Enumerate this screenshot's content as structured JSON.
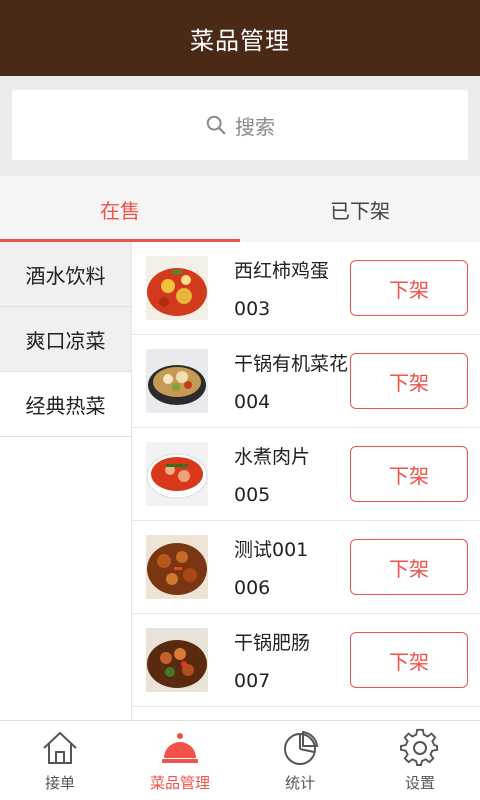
{
  "header": {
    "title": "菜品管理"
  },
  "search": {
    "placeholder": "搜索"
  },
  "tabs": [
    {
      "label": "在售",
      "active": true
    },
    {
      "label": "已下架",
      "active": false
    }
  ],
  "categories": [
    {
      "label": "酒水饮料"
    },
    {
      "label": "爽口凉菜"
    },
    {
      "label": "经典热菜"
    }
  ],
  "dishes": [
    {
      "name": "西红柿鸡蛋",
      "code": "003",
      "action": "下架"
    },
    {
      "name": "干锅有机菜花",
      "code": "004",
      "action": "下架"
    },
    {
      "name": "水煮肉片",
      "code": "005",
      "action": "下架"
    },
    {
      "name": "测试001",
      "code": "006",
      "action": "下架"
    },
    {
      "name": "干锅肥肠",
      "code": "007",
      "action": "下架"
    }
  ],
  "bottom_nav": [
    {
      "label": "接单",
      "icon": "home-icon"
    },
    {
      "label": "菜品管理",
      "icon": "cloche-icon",
      "active": true
    },
    {
      "label": "统计",
      "icon": "pie-chart-icon"
    },
    {
      "label": "设置",
      "icon": "gear-icon"
    }
  ],
  "colors": {
    "header": "#4a2a17",
    "accent": "#f0524a"
  }
}
